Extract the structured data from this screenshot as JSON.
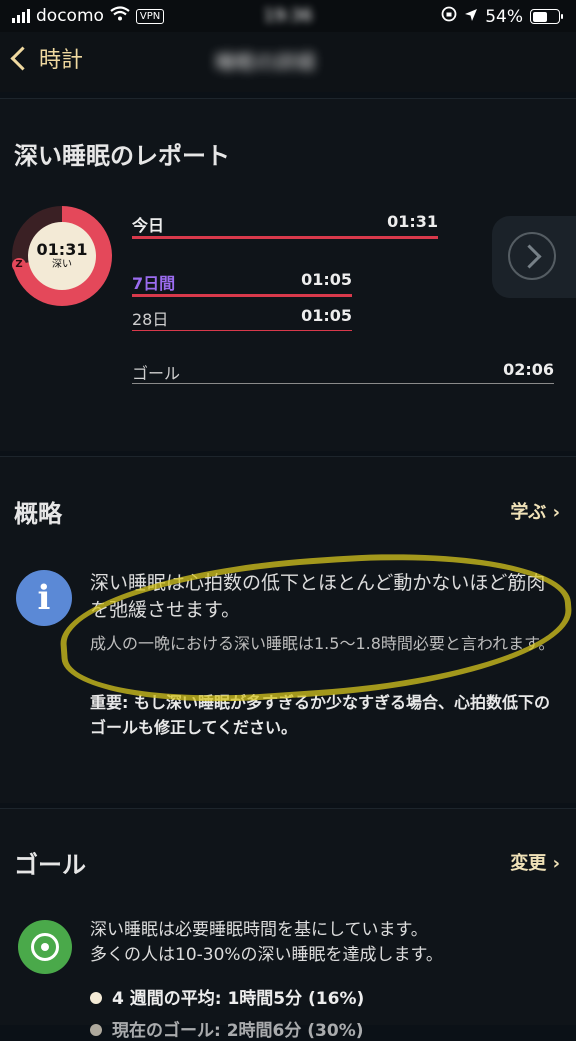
{
  "status_bar": {
    "carrier": "docomo",
    "vpn": "VPN",
    "time": "19:36",
    "battery": "54%"
  },
  "nav": {
    "back_label": "時計",
    "title": "睡眠の詳細"
  },
  "report": {
    "title": "深い睡眠のレポート",
    "ring": {
      "time": "01:31",
      "label": "深い",
      "z": "Z",
      "progress": 0.72
    },
    "rows": [
      {
        "label": "今日",
        "value": "01:31"
      },
      {
        "label": "7日間",
        "value": "01:05"
      },
      {
        "label": "28日",
        "value": "01:05"
      }
    ],
    "goal": {
      "label": "ゴール",
      "value": "02:06"
    }
  },
  "overview": {
    "title": "概略",
    "learn_label": "学ぶ ›",
    "icon": "i",
    "text1": "深い睡眠は心拍数の低下とほとんど動かないほど筋肉を弛緩させます。",
    "text2": "成人の一晩における深い睡眠は1.5〜1.8時間必要と言われます。",
    "text3": "重要: もし深い睡眠が多すぎるか少なすぎる場合、心拍数低下のゴールも修正してください。"
  },
  "goal_section": {
    "title": "ゴール",
    "change_label": "変更 ›",
    "text1": "深い睡眠は必要睡眠時間を基にしています。",
    "text2": "多くの人は10-30%の深い睡眠を達成します。",
    "bullet1": "4 週間の平均: 1時間5分 (16%)",
    "bullet2": "現在のゴール: 2時間6分 (30%)"
  },
  "colors": {
    "accent": "#e4485a",
    "seven_day": "#9b6cf0",
    "nav": "#f0d9a0",
    "info": "#5b89d6",
    "goal": "#4aa94a"
  }
}
